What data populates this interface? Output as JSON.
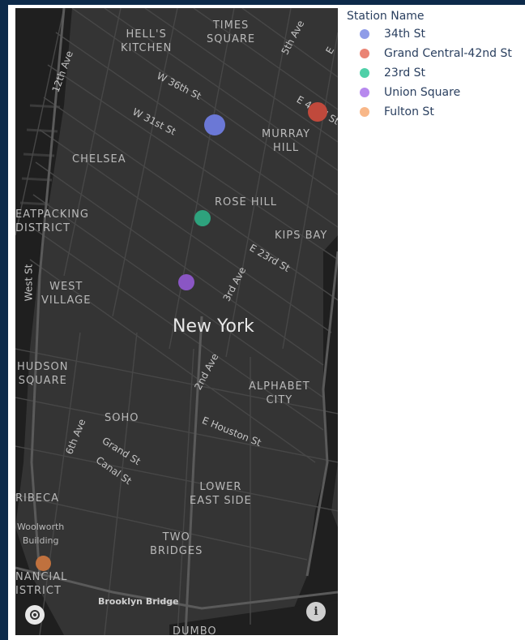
{
  "legend": {
    "title": "Station Name",
    "items": [
      {
        "label": "34th St",
        "color": "#8f9ce8"
      },
      {
        "label": "Grand Central-42nd St",
        "color": "#ea8474"
      },
      {
        "label": "23rd St",
        "color": "#4fd0a8"
      },
      {
        "label": "Union Square",
        "color": "#b789ee"
      },
      {
        "label": "Fulton St",
        "color": "#f8b788"
      }
    ]
  },
  "markers": [
    {
      "station": "34th St",
      "color": "#6b78d6"
    },
    {
      "station": "Grand Central-42nd St",
      "color": "#c0493c"
    },
    {
      "station": "23rd St",
      "color": "#2ea27d"
    },
    {
      "station": "Union Square",
      "color": "#8a56c4"
    },
    {
      "station": "Fulton St",
      "color": "#c0713e"
    }
  ],
  "map": {
    "city_label": "New York",
    "neighborhoods": {
      "hells_kitchen": "HELL'S\nKITCHEN",
      "times_square": "TIMES\nSQUARE",
      "chelsea": "CHELSEA",
      "murray_hill": "MURRAY\nHILL",
      "rose_hill": "ROSE HILL",
      "meatpacking": "EATPACKING\nDISTRICT",
      "kips_bay": "KIPS BAY",
      "west_village": "WEST\nVILLAGE",
      "hudson_square": "HUDSON\nSQUARE",
      "alphabet_city": "ALPHABET\nCITY",
      "soho": "SOHO",
      "tribeca": "RIBECA",
      "lower_east_side": "LOWER\nEAST SIDE",
      "two_bridges": "TWO\nBRIDGES",
      "woolworth": "Woolworth\nBuilding",
      "financial_district": "NANCIAL\nISTRICT",
      "dumbo": "DUMBO"
    },
    "streets": {
      "12th_ave": "12th Ave",
      "w36": "W 36th St",
      "w31": "W 31st St",
      "5th_ave": "5th Ave",
      "e42": "E 42nd St",
      "e_short": "E",
      "e23": "E 23rd St",
      "3rd_ave": "3rd Ave",
      "west_st": "West St",
      "2nd_ave": "2nd Ave",
      "6th_ave": "6th Ave",
      "e_houston": "E Houston St",
      "grand": "Grand St",
      "canal": "Canal St"
    },
    "bridge_label": "Brooklyn Bridge",
    "logo_icon": "mapbox-logo-icon",
    "info_icon": "info-icon",
    "info_glyph": "i"
  }
}
